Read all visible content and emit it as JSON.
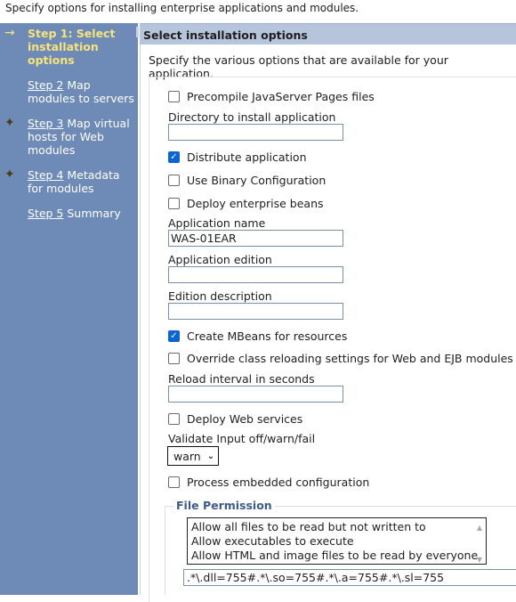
{
  "page_description": "Specify options for installing enterprise applications and modules.",
  "sidebar": {
    "steps": [
      {
        "link": "Step 1: Select installation options",
        "rest": "",
        "marker": "arrow-icon",
        "current": true
      },
      {
        "link": "Step 2",
        "rest": " Map modules to servers",
        "marker": ""
      },
      {
        "link": "Step 3",
        "rest": " Map virtual hosts for Web modules",
        "marker": "required-star-icon"
      },
      {
        "link": "Step 4",
        "rest": " Metadata for modules",
        "marker": "required-star-icon"
      },
      {
        "link": "Step 5",
        "rest": " Summary",
        "marker": ""
      }
    ]
  },
  "main": {
    "title": "Select installation options",
    "intro": "Specify the various options that are available for your application.",
    "precompile": {
      "label": "Precompile JavaServer Pages files",
      "checked": false
    },
    "install_dir": {
      "label": "Directory to install application",
      "value": ""
    },
    "distribute": {
      "label": "Distribute application",
      "checked": true
    },
    "binary": {
      "label": "Use Binary Configuration",
      "checked": false
    },
    "deploy_ejb": {
      "label": "Deploy enterprise beans",
      "checked": false
    },
    "app_name": {
      "label": "Application name",
      "value": "WAS-01EAR"
    },
    "app_edition": {
      "label": "Application edition",
      "value": ""
    },
    "edition_desc": {
      "label": "Edition description",
      "value": ""
    },
    "mbeans": {
      "label": "Create MBeans for resources",
      "checked": true
    },
    "override": {
      "label": "Override class reloading settings for Web and EJB modules",
      "checked": false
    },
    "reload": {
      "label": "Reload interval in seconds",
      "value": ""
    },
    "deploy_ws": {
      "label": "Deploy Web services",
      "checked": false
    },
    "validate": {
      "label": "Validate Input off/warn/fail",
      "value": "warn"
    },
    "embedded": {
      "label": "Process embedded configuration",
      "checked": false
    },
    "file_permission": {
      "legend": "File Permission",
      "options": [
        "Allow all files to be read but not written to",
        "Allow executables to execute",
        "Allow HTML and image files to be read by everyone"
      ],
      "value": ".*\\.dll=755#.*\\.so=755#.*\\.a=755#.*\\.sl=755"
    }
  }
}
